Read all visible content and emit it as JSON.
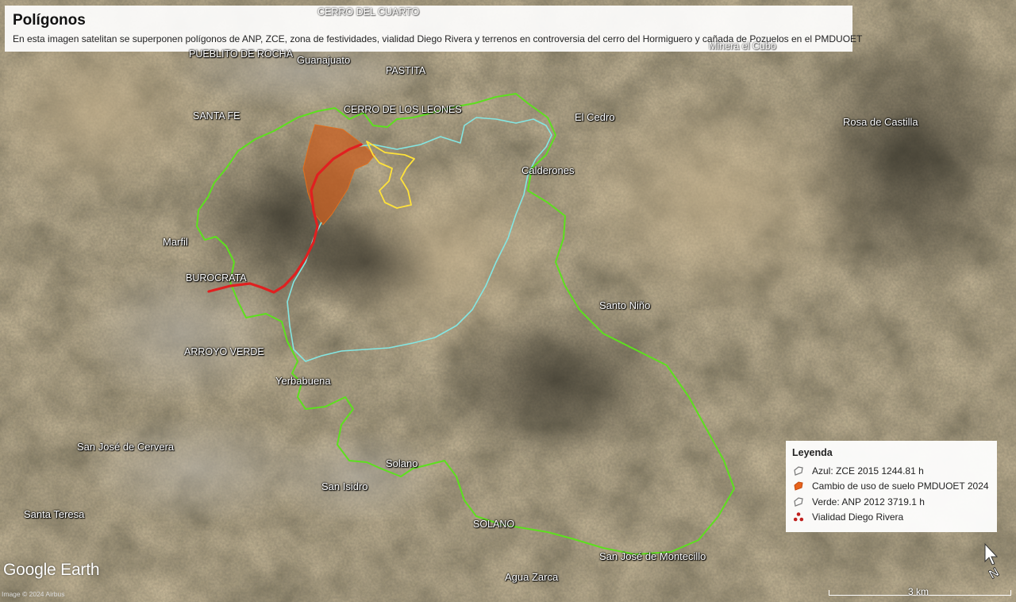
{
  "header": {
    "title": "Polígonos",
    "subtitle": "En esta imagen satelitan se superponen polígonos de ANP, ZCE, zona de festividades, vialidad Diego Rivera y terrenos en controversia del cerro del Hormiguero y cañada de Pozuelos en el PMDUOET"
  },
  "places": {
    "cerro_cuarto": "CERRO DEL CUARTO",
    "pueblito_rocha": "PUEBLITO DE ROCHA",
    "guanajuato": "Guanajuato",
    "pastita": "PASTITA",
    "santa_fe": "SANTA FE",
    "cerro_leones": "CERRO DE LOS LEONES",
    "el_cedro": "El Cedro",
    "rosa_castilla": "Rosa de Castilla",
    "calderones": "Calderones",
    "marfil": "Marfil",
    "burocrata": "BUROCRATA",
    "santo_nino": "Santo Niño",
    "arroyo_verde": "ARROYO VERDE",
    "yerbabuena": "Yerbabuena",
    "san_jose_cervera": "San José de Cervera",
    "solano_1": "Solano",
    "san_isidro": "San Isidro",
    "santa_teresa": "Santa Teresa",
    "solano_2": "SOLANO",
    "san_jose_montecillo": "San José de Montecillo",
    "agua_zarca": "Agua Zarca",
    "minera_cubo": "Minera el Cubo"
  },
  "legend": {
    "title": "Leyenda",
    "items": [
      {
        "label": "Azul: ZCE 2015 1244.81 h",
        "icon": "outline-polygon-icon"
      },
      {
        "label": "Cambio de uso de suelo PMDUOET 2024",
        "icon": "orange-polygon-icon",
        "color": "#e8631c"
      },
      {
        "label": "Verde: ANP 2012 3719.1 h",
        "icon": "outline-polygon-icon"
      },
      {
        "label": "Vialidad Diego Rivera",
        "icon": "red-path-icon",
        "color": "#c0201e"
      }
    ]
  },
  "overlay_colors": {
    "anp_green": "#5de01e",
    "zce_blue": "#7fe3e0",
    "road_red": "#e02020",
    "festivity_yellow": "#ffe23a",
    "land_change_orange": "#c85a1a"
  },
  "footer": {
    "logo": "Google Earth",
    "credit": "Image © 2024 Airbus",
    "scale": "3 km"
  }
}
